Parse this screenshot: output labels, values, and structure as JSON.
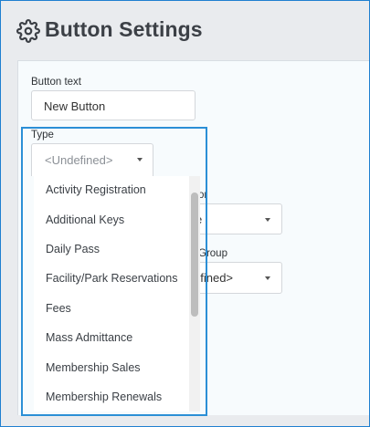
{
  "header": {
    "title": "Button Settings",
    "icon": "gear-icon"
  },
  "form": {
    "button_text_label": "Button text",
    "button_text_value": "New Button",
    "type_label": "Type",
    "type_placeholder": "<Undefined>",
    "behind_field1_label_fragment": "or",
    "behind_field1_value_fragment": "e",
    "behind_field2_label_fragment": "Group",
    "behind_field2_value_fragment": "efined>"
  },
  "dropdown": {
    "options": [
      "Activity Registration",
      "Additional Keys",
      "Daily Pass",
      "Facility/Park Reservations",
      "Fees",
      "Mass Admittance",
      "Membership Sales",
      "Membership Renewals"
    ]
  },
  "colors": {
    "highlight": "#2b8fd6",
    "frame": "#1f7fd0",
    "header_bg": "#e9ebee",
    "panel_bg": "#f7fbfd"
  }
}
